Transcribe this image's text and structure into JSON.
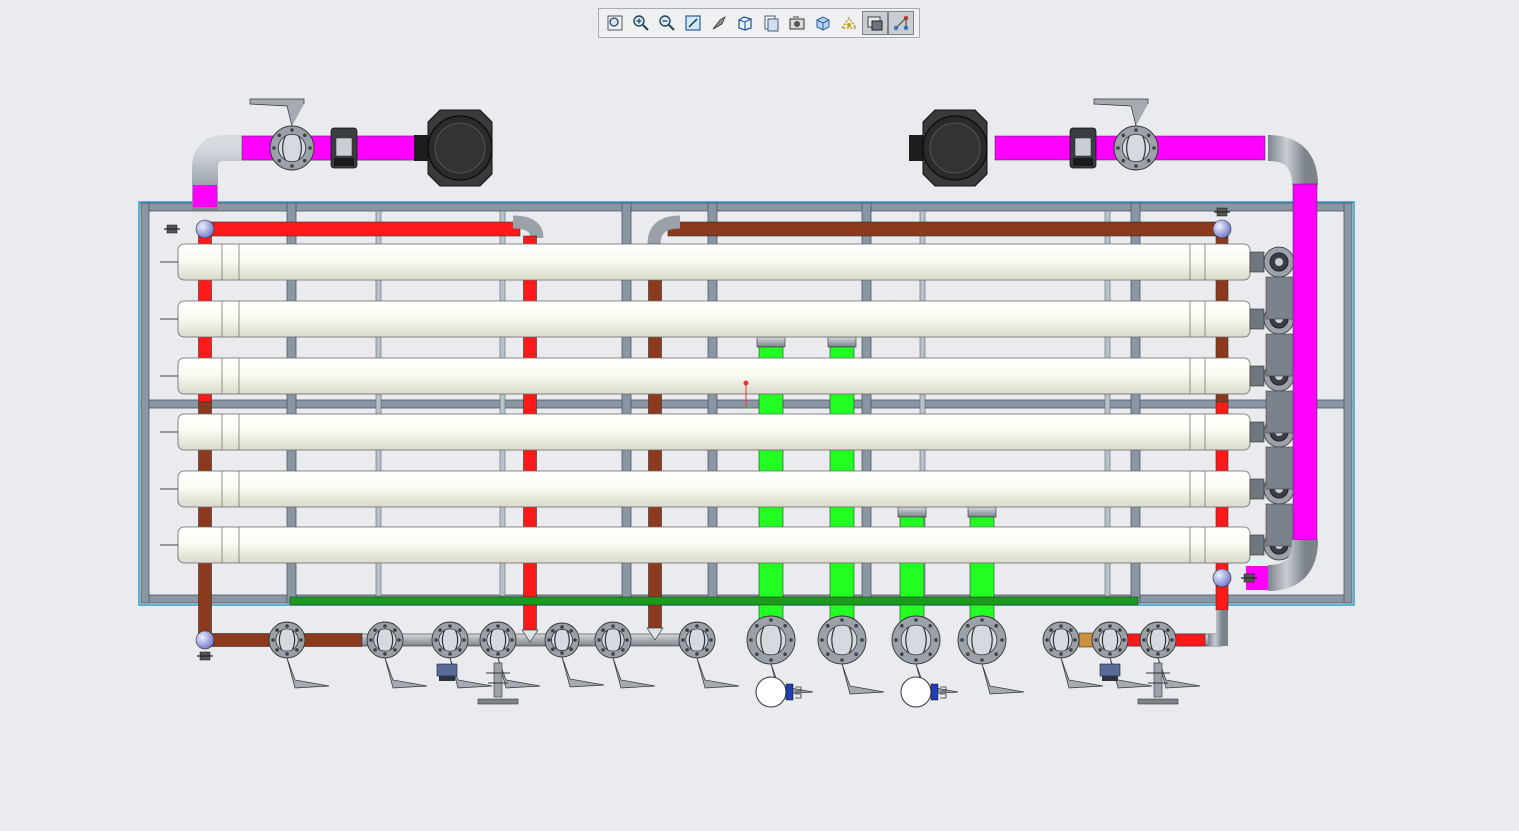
{
  "toolbar": {
    "tools": [
      {
        "icon": "zoom-to-fit-icon",
        "active": false
      },
      {
        "icon": "zoom-in-icon",
        "active": false
      },
      {
        "icon": "zoom-out-icon",
        "active": false
      },
      {
        "icon": "zoom-to-area-icon",
        "active": false
      },
      {
        "icon": "previous-view-icon",
        "active": false
      },
      {
        "icon": "view-orientation-cube-icon",
        "active": false
      },
      {
        "icon": "section-view-icon",
        "active": false
      },
      {
        "icon": "snapshot-camera-icon",
        "active": false
      },
      {
        "icon": "display-style-icon",
        "active": false
      },
      {
        "icon": "hide-show-items-icon",
        "active": false
      },
      {
        "icon": "edit-appearance-icon",
        "active": true
      },
      {
        "icon": "apply-scene-icon",
        "active": true
      }
    ]
  },
  "model": {
    "membrane_vessel_count": 6,
    "colors": {
      "background": "#e9ebee",
      "frame": "#8a96a3",
      "frame_edge": "#2c9fcf",
      "vessel": "#f7f7ec",
      "feed_pipe": "#ff00ff",
      "concentrate_pipe_red": "#ff1a1a",
      "brown_pipe": "#8b3a1e",
      "permeate_pipe_green": "#22ff22",
      "base_rail_green": "#1a9c1a",
      "valve_grey": "#9aa1a9",
      "pump_dark": "#2a2a2a"
    }
  }
}
